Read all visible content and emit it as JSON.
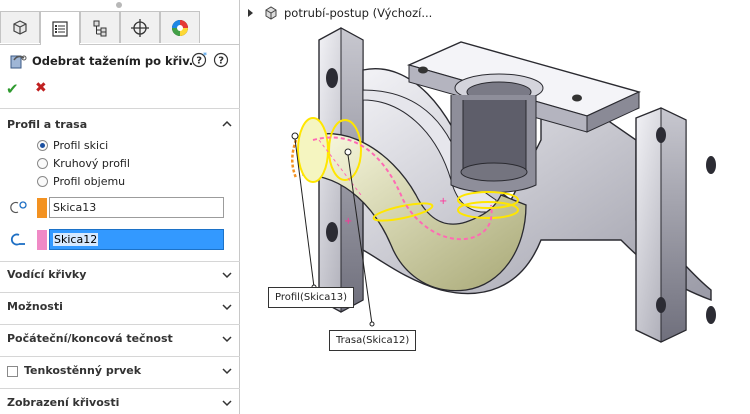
{
  "feature": {
    "title": "Odebrat tažením po křiv...",
    "help_icon": "help-with-star-icon",
    "info_icon": "help-icon"
  },
  "tabs": [
    {
      "name": "feature-manager",
      "icon": "feature-tree-icon"
    },
    {
      "name": "property-manager",
      "icon": "property-list-icon"
    },
    {
      "name": "configuration-manager",
      "icon": "configuration-icon"
    },
    {
      "name": "dimxpert-manager",
      "icon": "crosshair-icon"
    },
    {
      "name": "display-manager",
      "icon": "color-wheel-icon"
    }
  ],
  "profile_section": {
    "title": "Profil a trasa",
    "options": [
      {
        "label": "Profil skici",
        "selected": true
      },
      {
        "label": "Kruhový profil",
        "selected": false
      },
      {
        "label": "Profil objemu",
        "selected": false
      }
    ],
    "profile_field": "Skica13",
    "profile_color": "#f39221",
    "path_field": "Skica12",
    "path_color": "#f08ac6"
  },
  "sections": [
    {
      "title": "Vodící křivky"
    },
    {
      "title": "Možnosti"
    },
    {
      "title": "Počáteční/koncová tečnost"
    },
    {
      "title": "Tenkostěnný prvek"
    },
    {
      "title": "Zobrazení křivosti"
    }
  ],
  "tree": {
    "label": "potrubí-postup  (Výchozí..."
  },
  "callouts": {
    "profile": "Profil(Skica13)",
    "path": "Trasa(Skica12)"
  },
  "colors": {
    "accent_selection": "#3399ff",
    "ok": "#2f9a2f",
    "cancel": "#c02020",
    "highlight": "#ffff00",
    "path_preview": "#ff69b4"
  }
}
